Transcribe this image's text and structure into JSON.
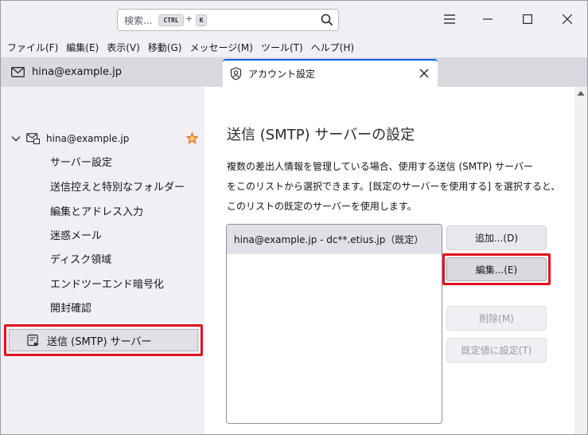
{
  "search": {
    "placeholder": "検索...",
    "kbd_ctrl": "CTRL",
    "kbd_plus": "+",
    "kbd_k": "K"
  },
  "menu": [
    "ファイル(F)",
    "編集(E)",
    "表示(V)",
    "移動(G)",
    "メッセージ(M)",
    "ツール(T)",
    "ヘルプ(H)"
  ],
  "tabs": {
    "mail_label": "hina@example.jp",
    "settings_label": "アカウント設定"
  },
  "sidebar": {
    "account": "hina@example.jp",
    "items": [
      "サーバー設定",
      "送信控えと特別なフォルダー",
      "編集とアドレス入力",
      "迷惑メール",
      "ディスク領域",
      "エンドツーエンド暗号化",
      "開封確認"
    ],
    "smtp": "送信 (SMTP) サーバー"
  },
  "main": {
    "title": "送信 (SMTP) サーバーの設定",
    "desc_lines": [
      "複数の差出人情報を管理している場合、使用する送信 (SMTP) サーバー",
      "をこのリストから選択できます。[既定のサーバーを使用する] を選択すると、",
      "このリストの既定のサーバーを使用します。"
    ],
    "servers": [
      "hina@example.jp - dc**.etius.jp（既定）"
    ],
    "buttons": {
      "add": "追加...(D)",
      "edit": "編集...(E)",
      "delete": "削除(M)",
      "default": "既定値に設定(T)"
    }
  },
  "colors": {
    "accent": "#0061e0",
    "highlight_border": "#e0141f",
    "star": "#e8641b"
  }
}
